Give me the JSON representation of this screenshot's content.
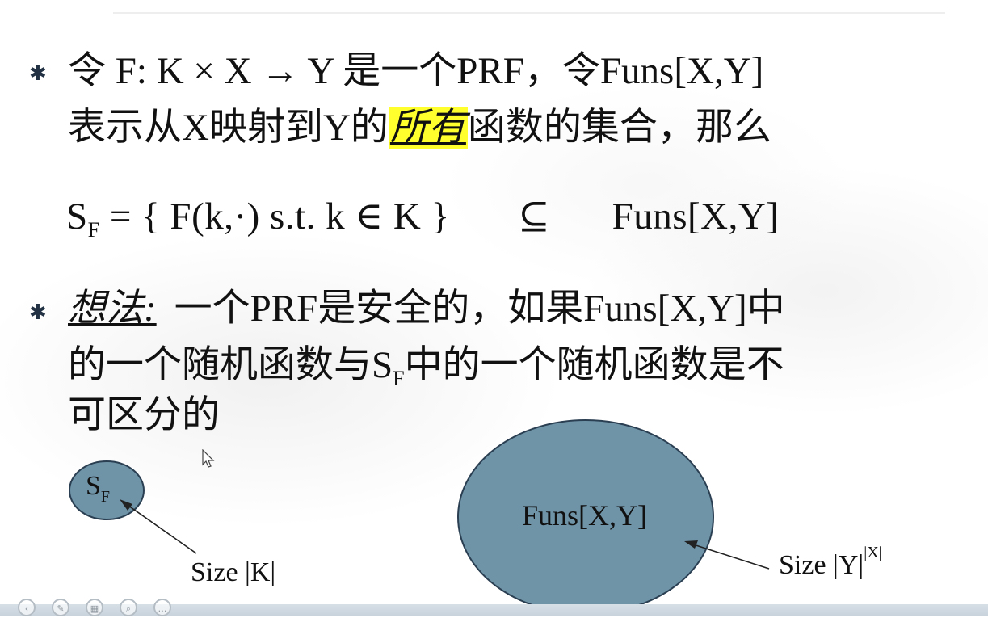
{
  "slide": {
    "bullet_symbol": "✱",
    "def": {
      "line1": "令 F:  K × X  →  Y 是一个PRF，令Funs[X,Y]",
      "line2_pre": "表示从X映射到Y的",
      "line2_highlight": "所有",
      "line2_post": "函数的集合，那么"
    },
    "formula": {
      "s_main": "S",
      "s_sub": "F",
      "body": "= {  F(k,·)   s.t.   k ∈ K  }",
      "subset": "⊆",
      "rhs": "Funs[X,Y]"
    },
    "idea": {
      "label": "想法:",
      "line1": "一个PRF是安全的，如果Funs[X,Y]中",
      "line2_pre": "的一个随机函数与S",
      "line2_sub": "F",
      "line2_post": "中的一个随机函数是不",
      "line3": "可区分的"
    },
    "diagram": {
      "small_set": {
        "main": "S",
        "sub": "F"
      },
      "small_size": "Size |K|",
      "big_set": "Funs[X,Y]",
      "big_size": "Size |Y|",
      "big_size_exp": "|X|",
      "ellipse_fill": "#6f94a8",
      "ellipse_stroke": "#2b3f52"
    },
    "highlight_color": "#ffff2d"
  },
  "taskbar": {
    "icons": [
      "previous-icon",
      "pen-icon",
      "slides-icon",
      "zoom-icon",
      "more-icon"
    ]
  }
}
